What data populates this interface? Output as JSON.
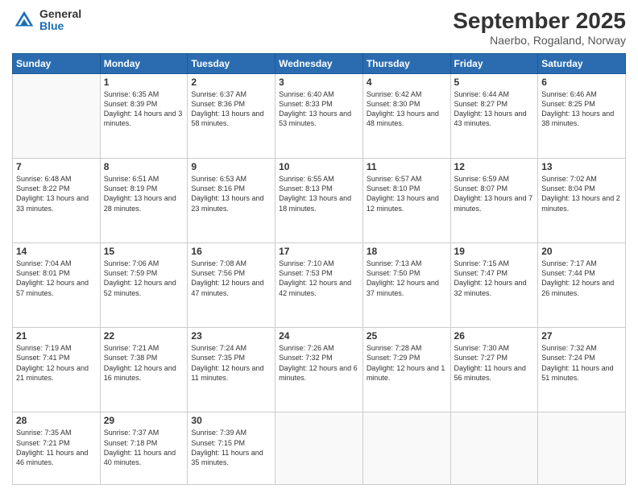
{
  "header": {
    "logo_general": "General",
    "logo_blue": "Blue",
    "month_title": "September 2025",
    "location": "Naerbo, Rogaland, Norway"
  },
  "weekdays": [
    "Sunday",
    "Monday",
    "Tuesday",
    "Wednesday",
    "Thursday",
    "Friday",
    "Saturday"
  ],
  "weeks": [
    [
      {
        "day": "",
        "sunrise": "",
        "sunset": "",
        "daylight": ""
      },
      {
        "day": "1",
        "sunrise": "Sunrise: 6:35 AM",
        "sunset": "Sunset: 8:39 PM",
        "daylight": "Daylight: 14 hours and 3 minutes."
      },
      {
        "day": "2",
        "sunrise": "Sunrise: 6:37 AM",
        "sunset": "Sunset: 8:36 PM",
        "daylight": "Daylight: 13 hours and 58 minutes."
      },
      {
        "day": "3",
        "sunrise": "Sunrise: 6:40 AM",
        "sunset": "Sunset: 8:33 PM",
        "daylight": "Daylight: 13 hours and 53 minutes."
      },
      {
        "day": "4",
        "sunrise": "Sunrise: 6:42 AM",
        "sunset": "Sunset: 8:30 PM",
        "daylight": "Daylight: 13 hours and 48 minutes."
      },
      {
        "day": "5",
        "sunrise": "Sunrise: 6:44 AM",
        "sunset": "Sunset: 8:27 PM",
        "daylight": "Daylight: 13 hours and 43 minutes."
      },
      {
        "day": "6",
        "sunrise": "Sunrise: 6:46 AM",
        "sunset": "Sunset: 8:25 PM",
        "daylight": "Daylight: 13 hours and 38 minutes."
      }
    ],
    [
      {
        "day": "7",
        "sunrise": "Sunrise: 6:48 AM",
        "sunset": "Sunset: 8:22 PM",
        "daylight": "Daylight: 13 hours and 33 minutes."
      },
      {
        "day": "8",
        "sunrise": "Sunrise: 6:51 AM",
        "sunset": "Sunset: 8:19 PM",
        "daylight": "Daylight: 13 hours and 28 minutes."
      },
      {
        "day": "9",
        "sunrise": "Sunrise: 6:53 AM",
        "sunset": "Sunset: 8:16 PM",
        "daylight": "Daylight: 13 hours and 23 minutes."
      },
      {
        "day": "10",
        "sunrise": "Sunrise: 6:55 AM",
        "sunset": "Sunset: 8:13 PM",
        "daylight": "Daylight: 13 hours and 18 minutes."
      },
      {
        "day": "11",
        "sunrise": "Sunrise: 6:57 AM",
        "sunset": "Sunset: 8:10 PM",
        "daylight": "Daylight: 13 hours and 12 minutes."
      },
      {
        "day": "12",
        "sunrise": "Sunrise: 6:59 AM",
        "sunset": "Sunset: 8:07 PM",
        "daylight": "Daylight: 13 hours and 7 minutes."
      },
      {
        "day": "13",
        "sunrise": "Sunrise: 7:02 AM",
        "sunset": "Sunset: 8:04 PM",
        "daylight": "Daylight: 13 hours and 2 minutes."
      }
    ],
    [
      {
        "day": "14",
        "sunrise": "Sunrise: 7:04 AM",
        "sunset": "Sunset: 8:01 PM",
        "daylight": "Daylight: 12 hours and 57 minutes."
      },
      {
        "day": "15",
        "sunrise": "Sunrise: 7:06 AM",
        "sunset": "Sunset: 7:59 PM",
        "daylight": "Daylight: 12 hours and 52 minutes."
      },
      {
        "day": "16",
        "sunrise": "Sunrise: 7:08 AM",
        "sunset": "Sunset: 7:56 PM",
        "daylight": "Daylight: 12 hours and 47 minutes."
      },
      {
        "day": "17",
        "sunrise": "Sunrise: 7:10 AM",
        "sunset": "Sunset: 7:53 PM",
        "daylight": "Daylight: 12 hours and 42 minutes."
      },
      {
        "day": "18",
        "sunrise": "Sunrise: 7:13 AM",
        "sunset": "Sunset: 7:50 PM",
        "daylight": "Daylight: 12 hours and 37 minutes."
      },
      {
        "day": "19",
        "sunrise": "Sunrise: 7:15 AM",
        "sunset": "Sunset: 7:47 PM",
        "daylight": "Daylight: 12 hours and 32 minutes."
      },
      {
        "day": "20",
        "sunrise": "Sunrise: 7:17 AM",
        "sunset": "Sunset: 7:44 PM",
        "daylight": "Daylight: 12 hours and 26 minutes."
      }
    ],
    [
      {
        "day": "21",
        "sunrise": "Sunrise: 7:19 AM",
        "sunset": "Sunset: 7:41 PM",
        "daylight": "Daylight: 12 hours and 21 minutes."
      },
      {
        "day": "22",
        "sunrise": "Sunrise: 7:21 AM",
        "sunset": "Sunset: 7:38 PM",
        "daylight": "Daylight: 12 hours and 16 minutes."
      },
      {
        "day": "23",
        "sunrise": "Sunrise: 7:24 AM",
        "sunset": "Sunset: 7:35 PM",
        "daylight": "Daylight: 12 hours and 11 minutes."
      },
      {
        "day": "24",
        "sunrise": "Sunrise: 7:26 AM",
        "sunset": "Sunset: 7:32 PM",
        "daylight": "Daylight: 12 hours and 6 minutes."
      },
      {
        "day": "25",
        "sunrise": "Sunrise: 7:28 AM",
        "sunset": "Sunset: 7:29 PM",
        "daylight": "Daylight: 12 hours and 1 minute."
      },
      {
        "day": "26",
        "sunrise": "Sunrise: 7:30 AM",
        "sunset": "Sunset: 7:27 PM",
        "daylight": "Daylight: 11 hours and 56 minutes."
      },
      {
        "day": "27",
        "sunrise": "Sunrise: 7:32 AM",
        "sunset": "Sunset: 7:24 PM",
        "daylight": "Daylight: 11 hours and 51 minutes."
      }
    ],
    [
      {
        "day": "28",
        "sunrise": "Sunrise: 7:35 AM",
        "sunset": "Sunset: 7:21 PM",
        "daylight": "Daylight: 11 hours and 46 minutes."
      },
      {
        "day": "29",
        "sunrise": "Sunrise: 7:37 AM",
        "sunset": "Sunset: 7:18 PM",
        "daylight": "Daylight: 11 hours and 40 minutes."
      },
      {
        "day": "30",
        "sunrise": "Sunrise: 7:39 AM",
        "sunset": "Sunset: 7:15 PM",
        "daylight": "Daylight: 11 hours and 35 minutes."
      },
      {
        "day": "",
        "sunrise": "",
        "sunset": "",
        "daylight": ""
      },
      {
        "day": "",
        "sunrise": "",
        "sunset": "",
        "daylight": ""
      },
      {
        "day": "",
        "sunrise": "",
        "sunset": "",
        "daylight": ""
      },
      {
        "day": "",
        "sunrise": "",
        "sunset": "",
        "daylight": ""
      }
    ]
  ]
}
